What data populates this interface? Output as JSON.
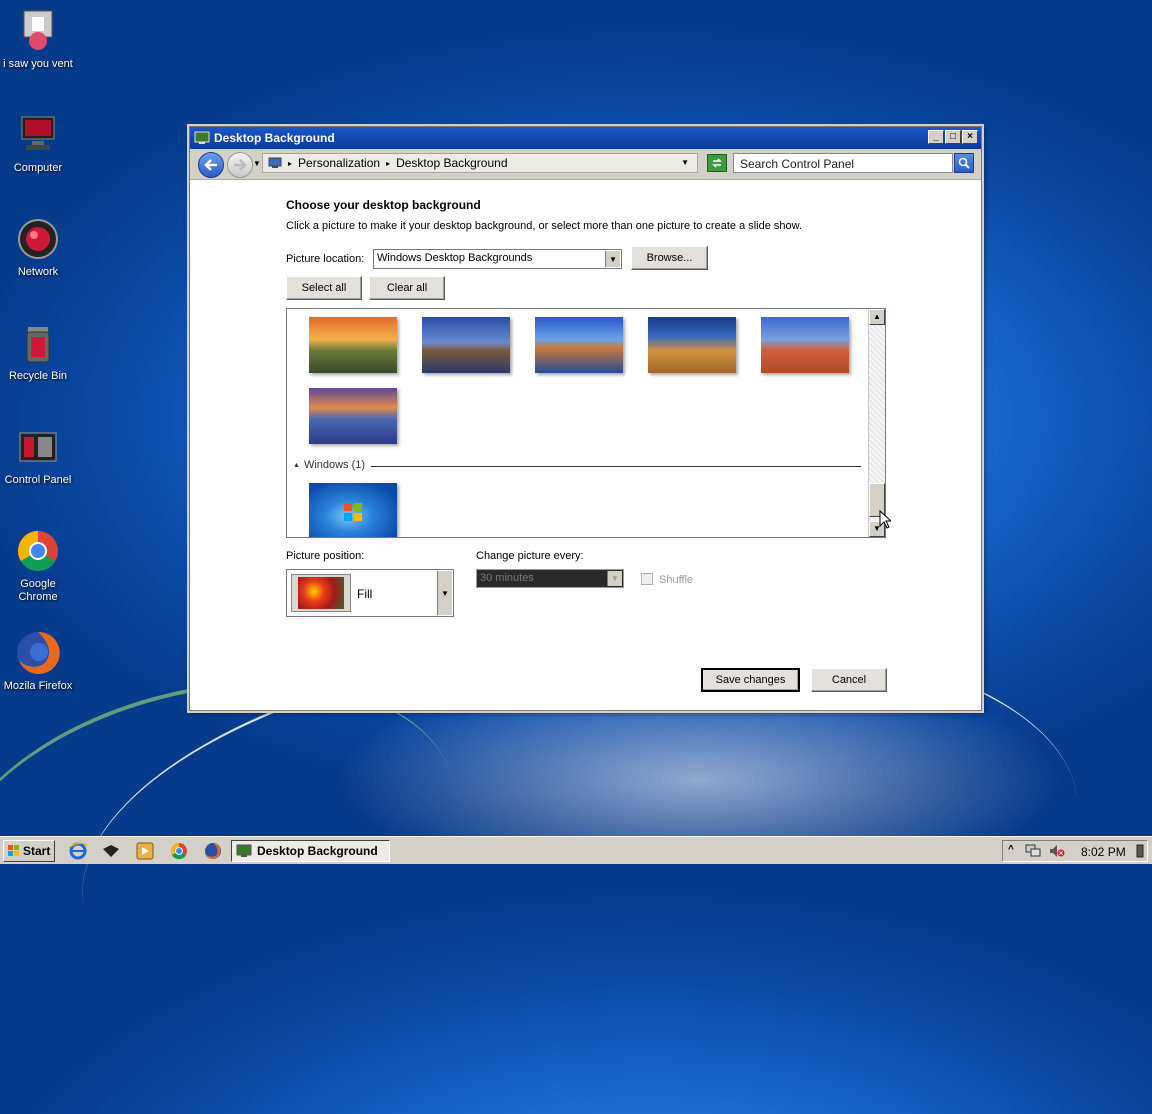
{
  "desktop": {
    "icons": [
      {
        "label": "i saw you vent"
      },
      {
        "label": "Computer"
      },
      {
        "label": "Network"
      },
      {
        "label": "Recycle Bin"
      },
      {
        "label": "Control Panel"
      },
      {
        "label": "Google Chrome"
      },
      {
        "label": "Mozila Firefox"
      }
    ]
  },
  "window": {
    "title": "Desktop Background",
    "breadcrumb": [
      "Personalization",
      "Desktop Background"
    ],
    "breadcrumb_sep": "▸",
    "search_placeholder": "Search Control Panel",
    "heading": "Choose your desktop background",
    "description": "Click a picture to make it your desktop background, or select more than one picture to create a slide show.",
    "picture_location_label": "Picture location:",
    "picture_location_value": "Windows Desktop Backgrounds",
    "browse_label": "Browse...",
    "select_all_label": "Select all",
    "clear_all_label": "Clear all",
    "group_windows_label": "Windows (1)",
    "picture_position_label": "Picture position:",
    "picture_position_value": "Fill",
    "change_picture_label": "Change picture every:",
    "change_picture_value": "30 minutes",
    "shuffle_label": "Shuffle",
    "save_label": "Save changes",
    "cancel_label": "Cancel"
  },
  "taskbar": {
    "start_label": "Start",
    "task_label": "Desktop Background",
    "clock": "8:02 PM"
  },
  "colors": {
    "titlebar": "#0a3a9c",
    "desktop": "#1c6ad0",
    "chrome": "#d4d0c8"
  }
}
